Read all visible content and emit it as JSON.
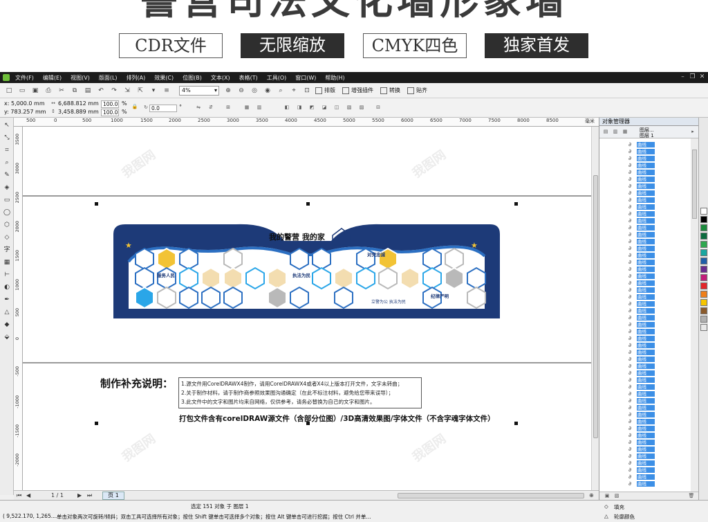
{
  "banner": {
    "title": "警营司法文化墙形象墙",
    "tags": [
      "CDR文件",
      "无限缩放",
      "CMYK四色",
      "独家首发"
    ]
  },
  "menubar": {
    "items": [
      "文件(F)",
      "编辑(E)",
      "视图(V)",
      "版面(L)",
      "排列(A)",
      "效果(C)",
      "位图(B)",
      "文本(X)",
      "表格(T)",
      "工具(O)",
      "窗口(W)",
      "帮助(H)"
    ]
  },
  "toolbar": {
    "zoom": "4%",
    "text_buttons": [
      "排版",
      "增强插件",
      "转换",
      "贴齐"
    ]
  },
  "propbar": {
    "x": "x: 5,000.0 mm",
    "y": "y: 783.257 mm",
    "w": "6,688.812 mm",
    "h": "3,458.889 mm",
    "scale_w": "100.0",
    "scale_h": "100.0",
    "pct": "%",
    "angle": "0.0",
    "deg": "°"
  },
  "ruler": {
    "labels": [
      "500",
      "0",
      "500",
      "1000",
      "1500",
      "2000",
      "2500",
      "3000",
      "3500",
      "4000",
      "4500",
      "5000",
      "5500",
      "6000",
      "6500",
      "7000",
      "7500",
      "8000",
      "8500"
    ],
    "unit": "毫米",
    "v_labels": [
      "3500",
      "3000",
      "2500",
      "2000",
      "1500",
      "1000",
      "500",
      "0",
      "-500",
      "-1000",
      "-1500",
      "-2000"
    ]
  },
  "design": {
    "headline": "我的警营 我的家",
    "hex_labels": [
      "服务人民",
      "执法为民",
      "对党忠诚",
      "纪律严明"
    ],
    "slogan": "立警为公 执法为民",
    "colors": {
      "navy": "#1d3a78",
      "blue": "#2b6fc2",
      "lightblue": "#2aa6e8",
      "gold": "#f2c335",
      "cream": "#f3ddb0",
      "grey": "#b9b9b9"
    }
  },
  "notes": {
    "title": "制作补充说明：",
    "lines": [
      "1.源文件用CorelDRAWX4制作，请用CorelDRAWX4或者X4以上版本打开文件，文字未转曲；",
      "2.关于制作材料，请于制作商参照效果图沟通确定（在此不标注材料，避免给您带来误导）；",
      "3.此文件中的文字和图片均来自网络，仅供参考，请务必替换为自己的文字和图片。"
    ],
    "pack": "打包文件含有corelDRAW源文件（含部分位图）/3D高清效果图/字体文件（不含字魂字体文件）"
  },
  "pagebar": {
    "page_count": "1 / 1",
    "page_tab": "页 1"
  },
  "status": {
    "selection": "选定 151 对象 于 图层 1",
    "coords": "( 9,522.170, 1,265....",
    "hint": "单击对象两次可旋转/倾斜；双击工具可选择所有对象；按住 Shift 键单击可选择多个对象；按住 Alt 键单击可进行挖掘；按住 Ctrl 并单...",
    "fill": "填充",
    "outline": "轮廓颜色"
  },
  "object_manager": {
    "title": "对象管理器",
    "layer_labels": [
      "图层...",
      "图层 1"
    ],
    "row_label": "曲线",
    "row_count": 50
  },
  "palette": {
    "colors": [
      "#ffffff",
      "#000000",
      "#1b8a3c",
      "#0c6b3f",
      "#2fa84f",
      "#19a7a1",
      "#1f5fa8",
      "#6a2b8e",
      "#c21d7a",
      "#e3262a",
      "#ef7f1a",
      "#f7c600",
      "#8a5a2b",
      "#b0b0b0",
      "#e8e8e8"
    ]
  },
  "watermark": "我图网"
}
